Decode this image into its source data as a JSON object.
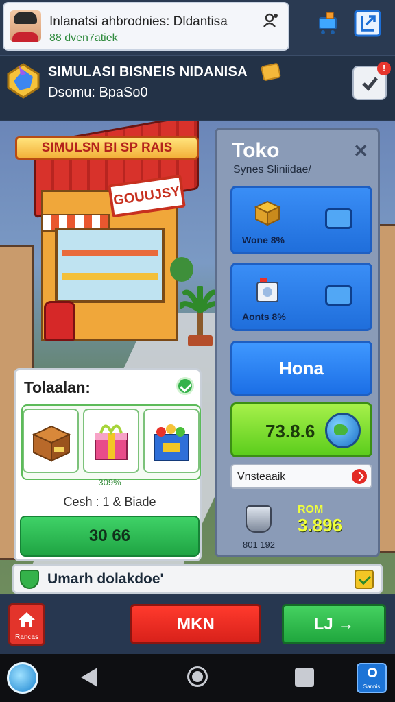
{
  "notification": {
    "title": "Inlanatsi ahbrodnies: Dldantisa",
    "subtitle": "88 dven7atiek"
  },
  "header": {
    "title": "SIMULASI BISNEIS NIDANISA",
    "subtitle": "Dsomu: BpaSo0",
    "badge": "!"
  },
  "scene": {
    "banner": "SIMULSN BI SP RAIS",
    "shop_sign": "GOUUJSY"
  },
  "inventory": {
    "title": "Tolaalan:",
    "percent": "309%",
    "cash": "Cesh : 1 & Biade",
    "button": "30 66"
  },
  "toko": {
    "title": "Toko",
    "close": "✕",
    "subtitle": "Synes Sliniidae/",
    "card1_label": "Wone 8%",
    "card2_label": "Aonts 8%",
    "big_button": "Hona",
    "green_value": "73.8.6",
    "input_value": "Vnsteaaik",
    "small_text": "801 192",
    "rom_label": "ROM",
    "rom_value": "3.896"
  },
  "strip": {
    "text": "Umarh dolakdoe'"
  },
  "actions": {
    "home_label": "Rancas",
    "mkn": "MKN",
    "lj": "LJ →"
  },
  "nav": {
    "right_label": "Sannis"
  },
  "icons": {
    "avatar": "avatar",
    "bell": "person-bell-icon",
    "cart": "cart-icon",
    "export": "export-icon",
    "logo": "game-logo-icon",
    "check": "checkmark-icon"
  }
}
